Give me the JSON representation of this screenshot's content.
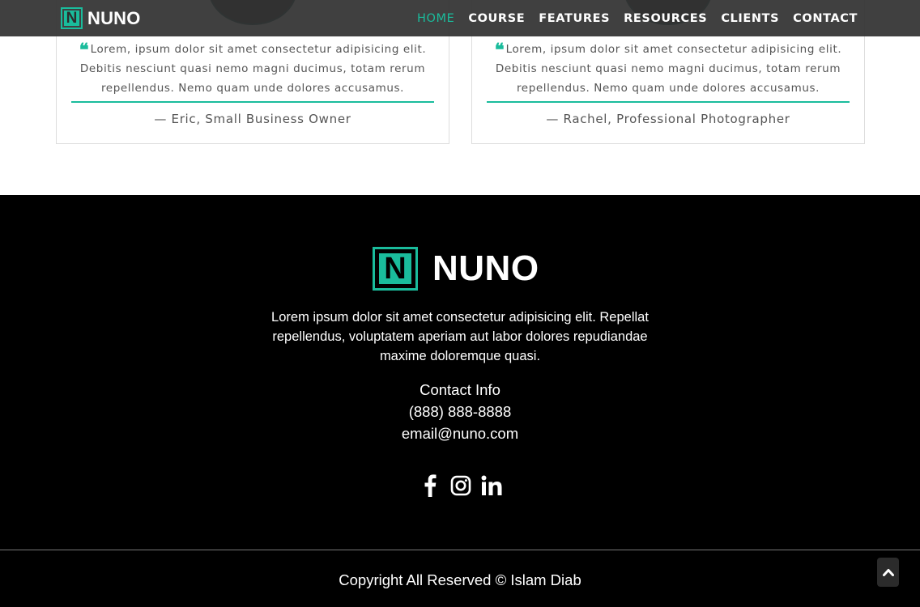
{
  "nav": {
    "brand": "NUNO",
    "logo_letter": "N",
    "items": [
      {
        "label": "HOME",
        "active": true
      },
      {
        "label": "COURSE"
      },
      {
        "label": "FEATURES"
      },
      {
        "label": "RESOURCES"
      },
      {
        "label": "CLIENTS"
      },
      {
        "label": "CONTACT"
      }
    ]
  },
  "testimonials": [
    {
      "quote": "Lorem, ipsum dolor sit amet consectetur adipisicing elit. Debitis nesciunt quasi nemo magni ducimus, totam rerum repellendus. Nemo quam unde dolores accusamus.",
      "author": "— Eric, Small Business Owner"
    },
    {
      "quote": "Lorem, ipsum dolor sit amet consectetur adipisicing elit. Debitis nesciunt quasi nemo magni ducimus, totam rerum repellendus. Nemo quam unde dolores accusamus.",
      "author": "— Rachel, Professional Photographer"
    }
  ],
  "footer": {
    "brand": "NUNO",
    "logo_letter": "N",
    "description": "Lorem ipsum dolor sit amet consectetur adipisicing elit. Repellat repellendus, voluptatem aperiam aut labor dolores repudiandae maxime doloremque quasi.",
    "contact_title": "Contact Info",
    "phone": "(888) 888-8888",
    "email": "email@nuno.com",
    "socials": [
      "facebook-icon",
      "instagram-icon",
      "linkedin-icon"
    ],
    "copyright": "Copyright All Reserved © Islam Diab"
  },
  "colors": {
    "accent": "#1abc9c",
    "nav_bg": "#323232",
    "footer_bg": "#000000"
  }
}
